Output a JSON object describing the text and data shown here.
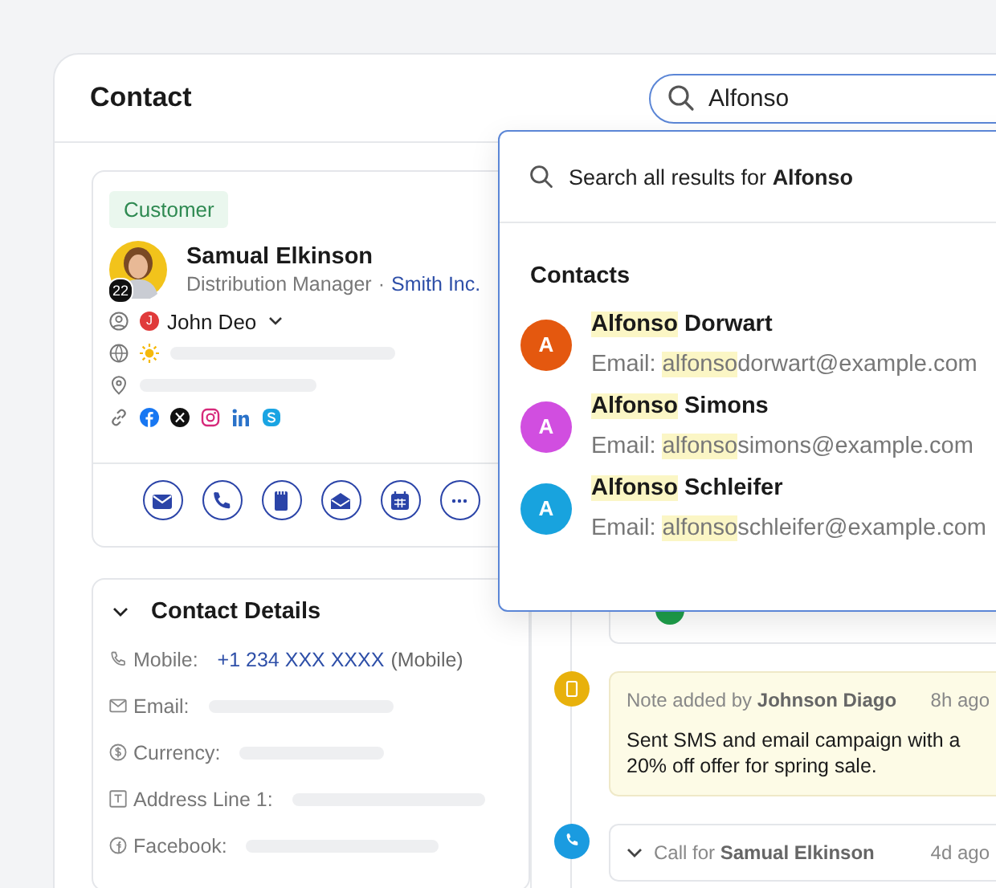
{
  "header": {
    "title": "Contact"
  },
  "search": {
    "value": "Alfonso"
  },
  "customer": {
    "tag": "Customer",
    "badge": "22",
    "name": "Samual Elkinson",
    "role": "Distribution Manager",
    "separator": "·",
    "company": "Smith Inc.",
    "owner_initial": "J",
    "owner": "John Deo"
  },
  "actions": [
    {
      "kind": "email"
    },
    {
      "kind": "call"
    },
    {
      "kind": "note"
    },
    {
      "kind": "mail-open"
    },
    {
      "kind": "calendar"
    },
    {
      "kind": "more"
    }
  ],
  "details": {
    "title": "Contact Details",
    "expanded": true,
    "fields": [
      {
        "label": "Mobile:",
        "value": "+1 234 XXX XXXX",
        "suffix": "(Mobile)"
      },
      {
        "label": "Email:"
      },
      {
        "label": "Currency:"
      },
      {
        "label": "Address Line 1:"
      },
      {
        "label": "Facebook:"
      }
    ]
  },
  "timeline": [
    {
      "kind": "event",
      "color": "#1e9e4a"
    },
    {
      "kind": "note",
      "color": "#e8b10c",
      "title": "Note added by **Johnson Diago**",
      "time": "8h ago",
      "body": "Sent SMS and email campaign with a 20% off offer for spring sale."
    },
    {
      "kind": "call",
      "color": "#1a9be0",
      "title": "Call for **Samual Elkinson**",
      "time": "4d ago"
    }
  ],
  "dropdown": {
    "search_all": "Search all results for **Alfonso**",
    "section": "Contacts",
    "results": [
      {
        "initial": "A",
        "color": "#e4580f",
        "name_match": "Alfonso",
        "name_rest": " Dorwart",
        "email_label": "Email:",
        "email_match": "alfonso",
        "email_rest": "dorwart@example.com"
      },
      {
        "initial": "A",
        "color": "#d14ee0",
        "name_match": "Alfonso",
        "name_rest": " Simons",
        "email_label": "Email:",
        "email_match": "alfonso",
        "email_rest": "simons@example.com"
      },
      {
        "initial": "A",
        "color": "#18a3de",
        "name_match": "Alfonso",
        "name_rest": " Schleifer",
        "email_label": "Email:",
        "email_match": "alfonso",
        "email_rest": "schleifer@example.com"
      }
    ]
  }
}
